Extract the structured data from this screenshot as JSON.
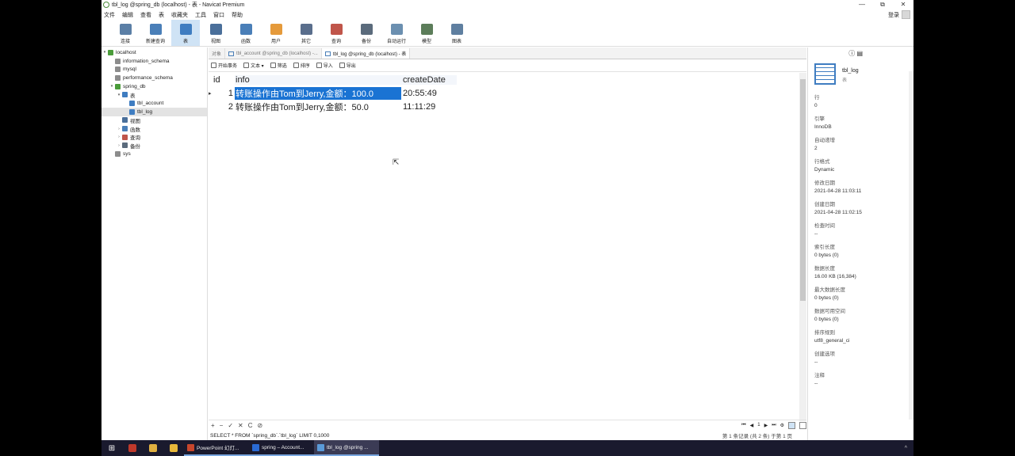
{
  "window": {
    "title": "tbl_log @spring_db (localhost) - 表 - Navicat Premium",
    "minimize": "—",
    "maximize": "⧉",
    "close": "✕"
  },
  "menubar": {
    "items": [
      "文件",
      "编辑",
      "查看",
      "表",
      "收藏夹",
      "工具",
      "窗口",
      "帮助"
    ],
    "login": "登录"
  },
  "toolbar": {
    "items": [
      {
        "label": "连接",
        "icon": "connection-icon",
        "color": "#5b7fa6"
      },
      {
        "label": "新建查询",
        "icon": "new-query-icon",
        "color": "#4a7fb8"
      },
      {
        "label": "表",
        "icon": "table-icon",
        "color": "#3f7dc1"
      },
      {
        "label": "视图",
        "icon": "view-icon",
        "color": "#4a6f9a"
      },
      {
        "label": "函数",
        "icon": "function-icon",
        "color": "#4a7fb8"
      },
      {
        "label": "用户",
        "icon": "user-icon",
        "color": "#e59a3b"
      },
      {
        "label": "其它",
        "icon": "tools-icon",
        "color": "#5a6e8c"
      },
      {
        "label": "查询",
        "icon": "query-icon",
        "color": "#c0554a"
      },
      {
        "label": "备份",
        "icon": "backup-icon",
        "color": "#5b6b7c"
      },
      {
        "label": "自动运行",
        "icon": "autorun-icon",
        "color": "#6b8fb0"
      },
      {
        "label": "模型",
        "icon": "model-icon",
        "color": "#5c7d5a"
      },
      {
        "label": "图表",
        "icon": "chart-icon",
        "color": "#5f7fa0"
      }
    ]
  },
  "sidebar": {
    "items": [
      {
        "label": "localhost",
        "indent": 0,
        "twisty": "▾",
        "color": "#4a9c3a"
      },
      {
        "label": "information_schema",
        "indent": 1,
        "twisty": "",
        "color": "#8c8c8c"
      },
      {
        "label": "mysql",
        "indent": 1,
        "twisty": "",
        "color": "#8c8c8c"
      },
      {
        "label": "performance_schema",
        "indent": 1,
        "twisty": "",
        "color": "#8c8c8c"
      },
      {
        "label": "spring_db",
        "indent": 1,
        "twisty": "▾",
        "color": "#4a9c3a"
      },
      {
        "label": "表",
        "indent": 2,
        "twisty": "▾",
        "color": "#3f7dc1"
      },
      {
        "label": "tbl_account",
        "indent": 3,
        "twisty": "",
        "color": "#3f7dc1"
      },
      {
        "label": "tbl_log",
        "indent": 3,
        "twisty": "",
        "color": "#3f7dc1",
        "selected": true
      },
      {
        "label": "视图",
        "indent": 2,
        "twisty": "",
        "color": "#4a6f9a"
      },
      {
        "label": "函数",
        "indent": 2,
        "twisty": "›",
        "color": "#4a7fb8"
      },
      {
        "label": "查询",
        "indent": 2,
        "twisty": "›",
        "color": "#c0554a"
      },
      {
        "label": "备份",
        "indent": 2,
        "twisty": "›",
        "color": "#5b6b7c"
      },
      {
        "label": "sys",
        "indent": 1,
        "twisty": "",
        "color": "#8c8c8c"
      }
    ]
  },
  "tabs": [
    {
      "label": "对象",
      "active": false
    },
    {
      "label": "tbl_account @spring_db (localhost) -...",
      "active": false
    },
    {
      "label": "tbl_log @spring_db (localhost) - 表",
      "active": true
    }
  ],
  "actions": [
    "开始事务",
    "文本 ▾",
    "筛选",
    "排序",
    "导入",
    "导出"
  ],
  "grid": {
    "columns": [
      "id",
      "info",
      "createDate"
    ],
    "rows": [
      {
        "marker": "▸",
        "id": "1",
        "info": "转账操作由Tom到Jerry,金额：100.0",
        "createDate": "20:55:49"
      },
      {
        "marker": "",
        "id": "2",
        "info": "转账操作由Tom到Jerry,金额：50.0",
        "createDate": "11:11:29"
      }
    ]
  },
  "bottombar": {
    "buttons": [
      "+",
      "−",
      "✓",
      "✕",
      "C",
      "⊘"
    ],
    "pager": [
      "⏮",
      "◀",
      "1",
      "▶",
      "⏭",
      "⚙"
    ]
  },
  "status": {
    "sql": "SELECT * FROM `spring_db`.`tbl_log` LIMIT 0,1000",
    "record": "第 1 条记录 (共 2 条) 于第 1 页"
  },
  "rpanel": {
    "name": "tbl_log",
    "subtitle": "表",
    "props": [
      {
        "label": "行",
        "value": "0"
      },
      {
        "label": "引擎",
        "value": "InnoDB"
      },
      {
        "label": "自动递增",
        "value": "2"
      },
      {
        "label": "行格式",
        "value": "Dynamic"
      },
      {
        "label": "修改日期",
        "value": "2021-04-28 11:03:11"
      },
      {
        "label": "创建日期",
        "value": "2021-04-28 11:02:15"
      },
      {
        "label": "检查时间",
        "value": "--"
      },
      {
        "label": "索引长度",
        "value": "0 bytes (0)"
      },
      {
        "label": "数据长度",
        "value": "16.00 KB (16,384)"
      },
      {
        "label": "最大数据长度",
        "value": "0 bytes (0)"
      },
      {
        "label": "数据可用空间",
        "value": "0 bytes (0)"
      },
      {
        "label": "排序规则",
        "value": "utf8_general_ci"
      },
      {
        "label": "创建选项",
        "value": "--"
      },
      {
        "label": "注释",
        "value": "--"
      }
    ]
  },
  "taskbar": {
    "start": "⊞",
    "tasks": [
      {
        "label": "PowerPoint 幻灯...",
        "color": "#c8462c",
        "active": false
      },
      {
        "label": "spring – Account...",
        "color": "#2a6ad3",
        "active": false
      },
      {
        "label": "tbl_log @spring ...",
        "color": "#5a9ad8",
        "active": true
      }
    ],
    "pinned": [
      {
        "icon": "snipping-tool-icon",
        "color": "#c0392b"
      },
      {
        "icon": "file-explorer-icon",
        "color": "#e0b040"
      },
      {
        "icon": "chrome-icon",
        "color": "#e8b83a"
      }
    ],
    "tray": "^"
  }
}
